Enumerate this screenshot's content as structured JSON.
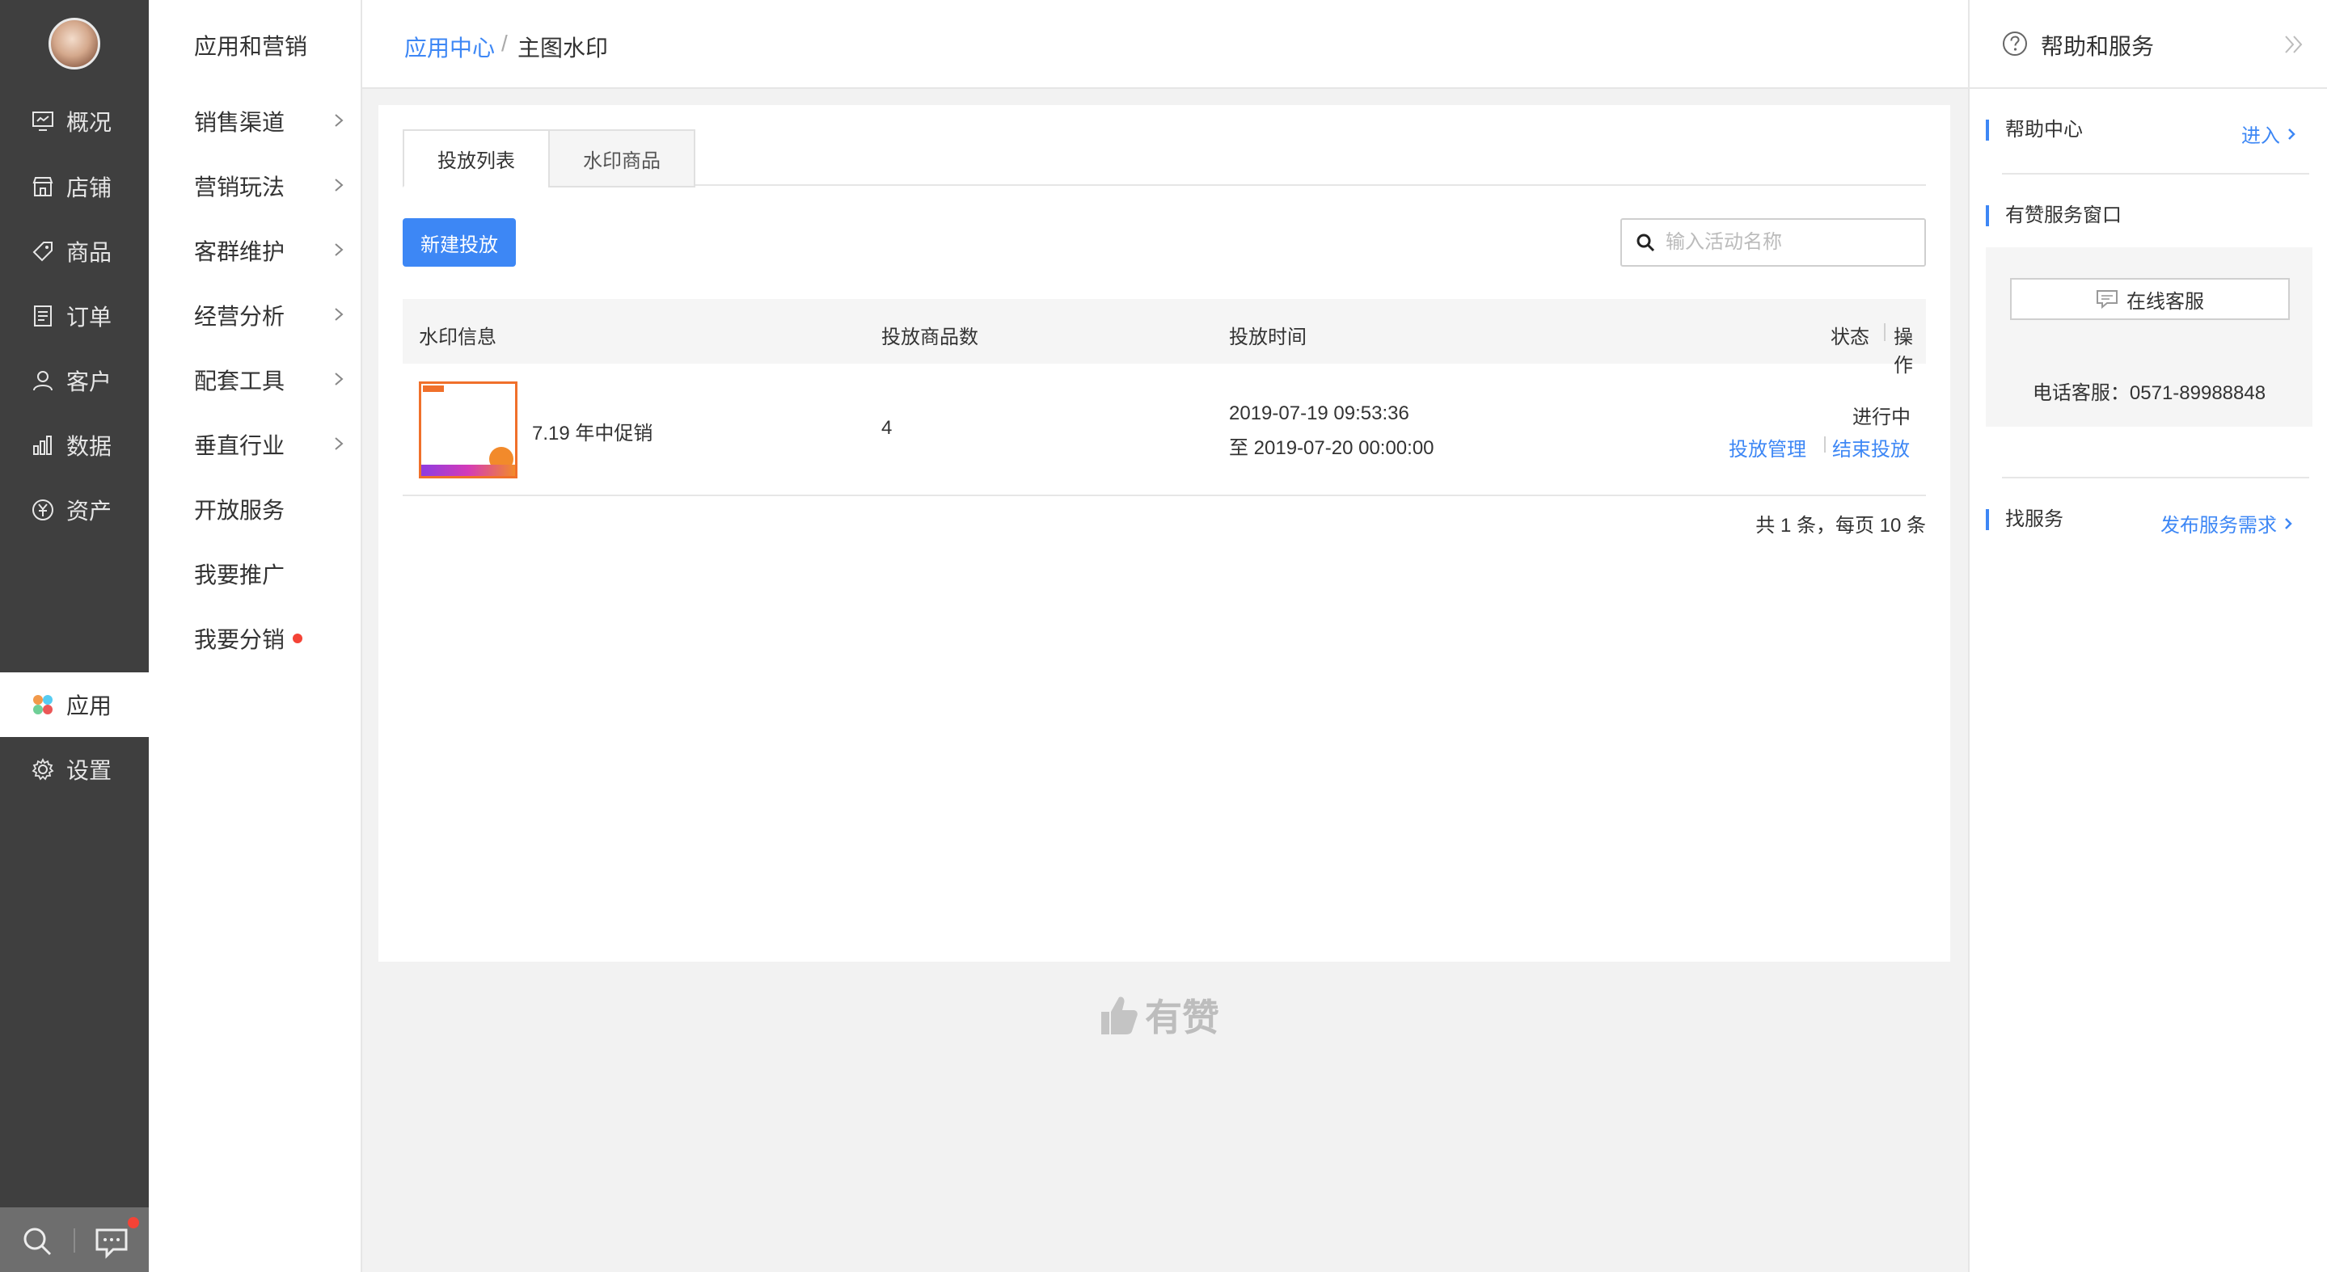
{
  "sidebar": {
    "items": [
      {
        "label": "概况",
        "icon": "overview-icon"
      },
      {
        "label": "店铺",
        "icon": "store-icon"
      },
      {
        "label": "商品",
        "icon": "tag-icon"
      },
      {
        "label": "订单",
        "icon": "order-icon"
      },
      {
        "label": "客户",
        "icon": "user-icon"
      },
      {
        "label": "数据",
        "icon": "chart-icon"
      },
      {
        "label": "资产",
        "icon": "yen-icon"
      }
    ],
    "active": {
      "label": "应用",
      "icon": "apps-icon"
    },
    "settings": {
      "label": "设置",
      "icon": "gear-icon"
    }
  },
  "subnav": {
    "title": "应用和营销",
    "items": [
      {
        "label": "销售渠道"
      },
      {
        "label": "营销玩法"
      },
      {
        "label": "客群维护"
      },
      {
        "label": "经营分析"
      },
      {
        "label": "配套工具"
      },
      {
        "label": "垂直行业"
      },
      {
        "label": "开放服务"
      },
      {
        "label": "我要推广"
      },
      {
        "label": "我要分销"
      }
    ]
  },
  "breadcrumb": {
    "parent": "应用中心",
    "separator": "/",
    "current": "主图水印"
  },
  "tabs": [
    "投放列表",
    "水印商品"
  ],
  "toolbar": {
    "new_button": "新建投放",
    "search_placeholder": "输入活动名称"
  },
  "table": {
    "headers": [
      "水印信息",
      "投放商品数",
      "投放时间",
      "状态",
      "操作"
    ],
    "rows": [
      {
        "name": "7.19 年中促销",
        "count": "4",
        "start": "2019-07-19 09:53:36",
        "end": "至 2019-07-20 00:00:00",
        "status": "进行中",
        "actions": [
          "投放管理",
          "结束投放"
        ]
      }
    ]
  },
  "pagination": "共 1 条，每页 10 条",
  "footer": {
    "brand": "有赞"
  },
  "help": {
    "title": "帮助和服务",
    "help_center": "帮助中心",
    "enter": "进入",
    "service_window": "有赞服务窗口",
    "online_service": "在线客服",
    "phone": "电话客服：0571-89988848",
    "find_service": "找服务",
    "publish_demand": "发布服务需求"
  },
  "colors": {
    "accent": "#3d87f5",
    "nav_bg": "#3f3f3f",
    "badge": "#f44336",
    "thumb_border": "#f0702b"
  }
}
